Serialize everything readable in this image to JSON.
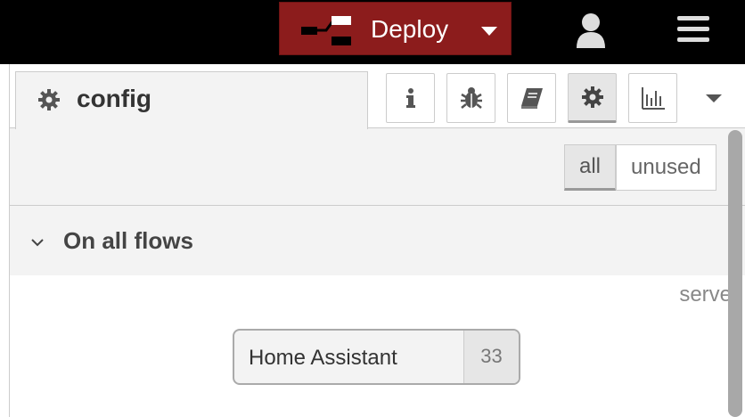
{
  "header": {
    "deploy_label": "Deploy",
    "deploy_color": "#8c1c1c",
    "icons": [
      "deploy-icon",
      "user-icon",
      "menu-icon",
      "chevron-down-icon"
    ]
  },
  "sidebar": {
    "tab": {
      "label": "config",
      "icon": "gear-icon"
    },
    "toolbar_icons": [
      "info-icon",
      "bug-icon",
      "book-icon",
      "gear-icon",
      "chart-icon"
    ],
    "filter": {
      "all": "all",
      "unused": "unused",
      "selected": "all"
    },
    "section": {
      "title": "On all flows"
    },
    "category": "server",
    "node": {
      "name": "Home Assistant",
      "count": "33"
    }
  }
}
